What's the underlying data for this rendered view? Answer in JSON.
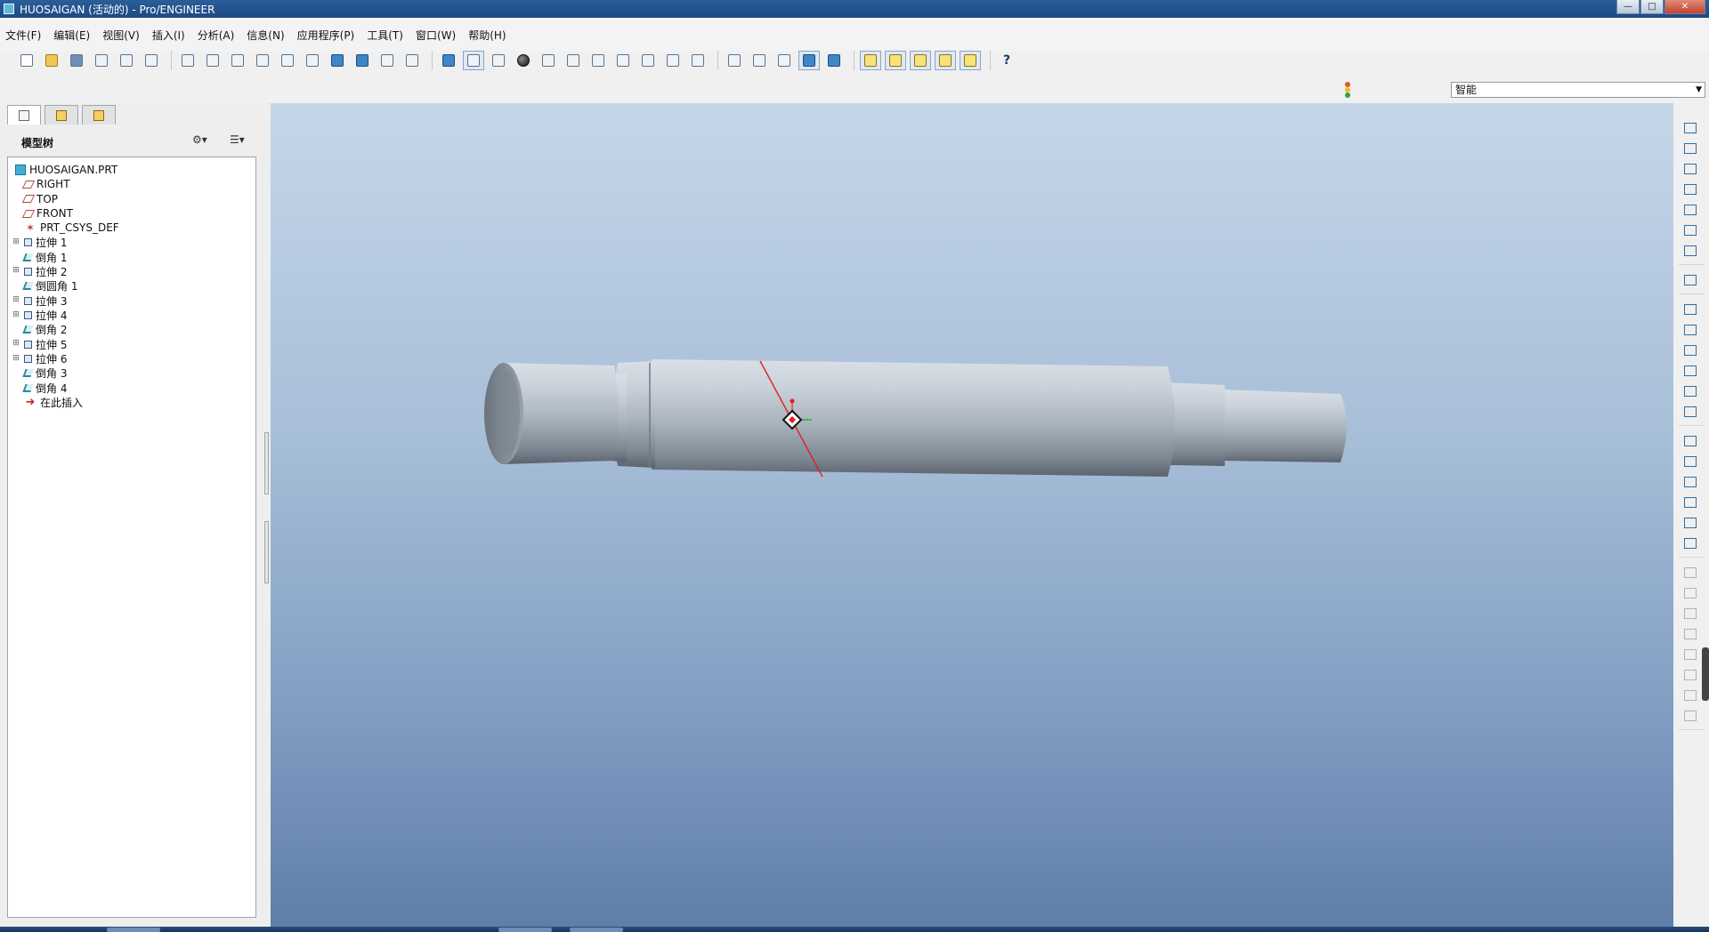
{
  "window": {
    "title": "HUOSAIGAN (活动的) - Pro/ENGINEER",
    "controls": {
      "minimize": "—",
      "maximize": "□",
      "close": "✕"
    }
  },
  "menu": [
    "文件(F)",
    "编辑(E)",
    "视图(V)",
    "插入(I)",
    "分析(A)",
    "信息(N)",
    "应用程序(P)",
    "工具(T)",
    "窗口(W)",
    "帮助(H)"
  ],
  "toolbar": {
    "icons": [
      "new-icon",
      "open-icon",
      "save-icon",
      "print-icon",
      "print-preview-icon",
      "email-icon",
      "undo-icon",
      "redo-icon",
      "cut-icon",
      "copy-icon",
      "paste-icon",
      "paste-special-icon",
      "regenerate-icon",
      "regenerate-manager-icon",
      "find-icon",
      "select-box-icon",
      "repaint-icon",
      "spin-center-icon",
      "orient-mode-icon",
      "shading-icon",
      "zoom-in-icon",
      "zoom-out-icon",
      "refit-icon",
      "reorient-icon",
      "saved-views-icon",
      "layers-icon",
      "view-manager-icon",
      "wireframe-icon",
      "hidden-line-icon",
      "no-hidden-icon",
      "shaded-icon",
      "enhanced-realism-icon",
      "datum-planes-display-icon",
      "datum-axes-display-icon",
      "datum-points-display-icon",
      "csys-display-icon",
      "annotations-display-icon",
      "context-help-icon"
    ],
    "help_glyph": "?"
  },
  "filter": {
    "selected": "智能"
  },
  "model_tree": {
    "title": "模型树",
    "settings_label": "▾",
    "show_label": "▾",
    "items": [
      {
        "label": "HUOSAIGAN.PRT",
        "icon": "part-icon",
        "expandable": false
      },
      {
        "label": "RIGHT",
        "icon": "datum-plane-icon",
        "expandable": false
      },
      {
        "label": "TOP",
        "icon": "datum-plane-icon",
        "expandable": false
      },
      {
        "label": "FRONT",
        "icon": "datum-plane-icon",
        "expandable": false
      },
      {
        "label": "PRT_CSYS_DEF",
        "icon": "csys-icon",
        "expandable": false
      },
      {
        "label": "拉伸 1",
        "icon": "extrude-icon",
        "expandable": true
      },
      {
        "label": "倒角 1",
        "icon": "chamfer-icon",
        "expandable": false
      },
      {
        "label": "拉伸 2",
        "icon": "extrude-icon",
        "expandable": true
      },
      {
        "label": "倒圆角 1",
        "icon": "round-icon",
        "expandable": false
      },
      {
        "label": "拉伸 3",
        "icon": "extrude-icon",
        "expandable": true
      },
      {
        "label": "拉伸 4",
        "icon": "extrude-icon",
        "expandable": true
      },
      {
        "label": "倒角 2",
        "icon": "chamfer-icon",
        "expandable": false
      },
      {
        "label": "拉伸 5",
        "icon": "extrude-icon",
        "expandable": true
      },
      {
        "label": "拉伸 6",
        "icon": "extrude-icon",
        "expandable": true
      },
      {
        "label": "倒角 3",
        "icon": "chamfer-icon",
        "expandable": false
      },
      {
        "label": "倒角 4",
        "icon": "chamfer-icon",
        "expandable": false
      },
      {
        "label": "在此插入",
        "icon": "insert-here-icon",
        "expandable": false
      }
    ]
  },
  "right_toolbar": [
    "sketch-tool-icon",
    "datum-plane-tool-icon",
    "datum-axis-tool-icon",
    "datum-curve-tool-icon",
    "datum-point-tool-icon",
    "datum-csys-tool-icon",
    "analysis-tool-icon",
    "sketcher-icon",
    "extrude-tool-icon",
    "revolve-tool-icon",
    "variable-sweep-icon",
    "boundary-blend-icon",
    "style-icon",
    "hole-tool-icon",
    "shell-tool-icon",
    "rib-tool-icon",
    "draft-tool-icon",
    "round-tool-icon",
    "chamfer-tool-icon",
    "copy-tool-icon",
    "mirror-tool-icon",
    "merge-tool-icon",
    "trim-tool-icon",
    "pattern-tool-icon",
    "extend-tool-icon",
    "offset-tool-icon",
    "thicken-tool-icon",
    "solidify-tool-icon"
  ],
  "status_light": {
    "colors": [
      "#e05a2a",
      "#f0c020",
      "#2ea34a"
    ]
  }
}
